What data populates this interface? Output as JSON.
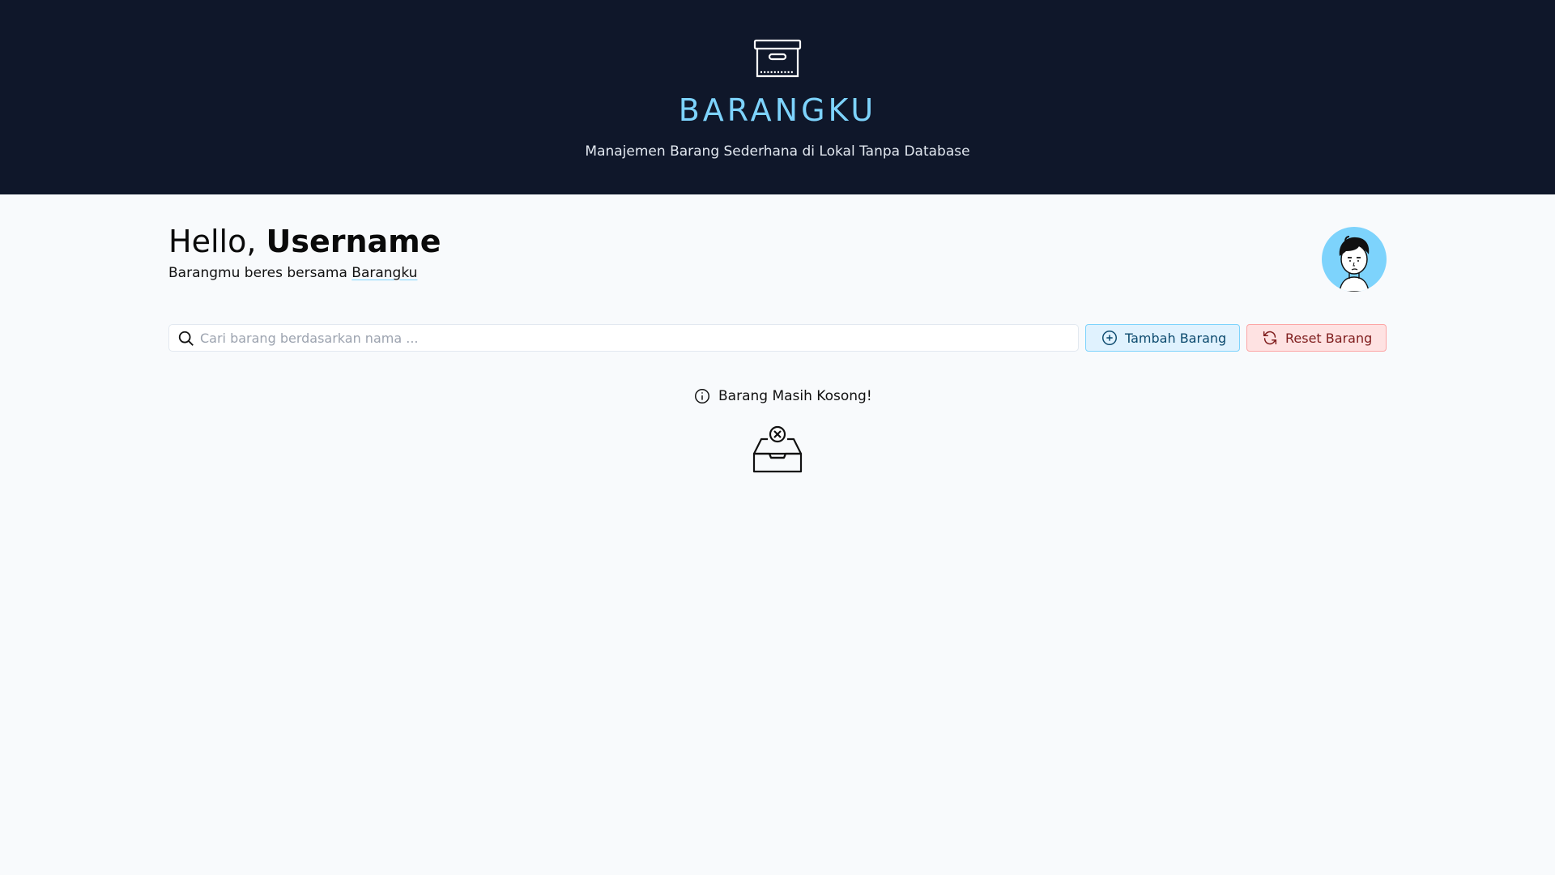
{
  "header": {
    "icon": "archive-box-icon",
    "title": "BARANGKU",
    "subtitle": "Manajemen Barang Sederhana di Lokal Tanpa Database"
  },
  "greeting": {
    "prefix": "Hello, ",
    "username": "Username",
    "tagline_prefix": "Barangmu beres bersama ",
    "tagline_link": "Barangku"
  },
  "avatar": {
    "icon": "user-avatar-illustration",
    "background": "#7dd3fc"
  },
  "search": {
    "icon": "search-icon",
    "placeholder": "Cari barang berdasarkan nama ...",
    "value": ""
  },
  "actions": {
    "add_label": "Tambah Barang",
    "add_icon": "plus-circle-icon",
    "reset_label": "Reset Barang",
    "reset_icon": "refresh-icon"
  },
  "empty_state": {
    "message": "Barang Masih Kosong!",
    "message_icon": "info-circle-icon",
    "illustration_icon": "empty-inbox-icon"
  },
  "colors": {
    "header_bg": "#0f172a",
    "accent": "#7dd3fc",
    "page_bg": "#f8fafc",
    "add_bg": "#e0f2fe",
    "reset_bg": "#fee2e2"
  }
}
